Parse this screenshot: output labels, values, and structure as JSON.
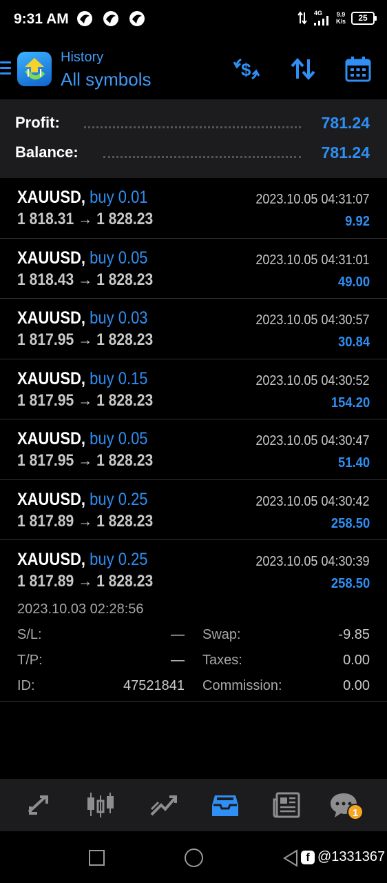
{
  "status_bar": {
    "time": "9:31 AM",
    "network_type": "4G",
    "net_speed_value": "9.9",
    "net_speed_unit": "K/s",
    "battery": "25"
  },
  "header": {
    "subtitle": "History",
    "title": "All symbols",
    "icons": [
      "menu-icon",
      "metatrader-logo",
      "currency-filter-icon",
      "sort-icon",
      "calendar-icon"
    ]
  },
  "summary": {
    "profit_label": "Profit:",
    "profit_value": "781.24",
    "balance_label": "Balance:",
    "balance_value": "781.24"
  },
  "deals": [
    {
      "symbol": "XAUUSD,",
      "side": "buy 0.01",
      "open_price": "1 818.31",
      "close_price": "1 828.23",
      "time": "2023.10.05 04:31:07",
      "profit": "9.92"
    },
    {
      "symbol": "XAUUSD,",
      "side": "buy 0.05",
      "open_price": "1 818.43",
      "close_price": "1 828.23",
      "time": "2023.10.05 04:31:01",
      "profit": "49.00"
    },
    {
      "symbol": "XAUUSD,",
      "side": "buy 0.03",
      "open_price": "1 817.95",
      "close_price": "1 828.23",
      "time": "2023.10.05 04:30:57",
      "profit": "30.84"
    },
    {
      "symbol": "XAUUSD,",
      "side": "buy 0.15",
      "open_price": "1 817.95",
      "close_price": "1 828.23",
      "time": "2023.10.05 04:30:52",
      "profit": "154.20"
    },
    {
      "symbol": "XAUUSD,",
      "side": "buy 0.05",
      "open_price": "1 817.95",
      "close_price": "1 828.23",
      "time": "2023.10.05 04:30:47",
      "profit": "51.40"
    },
    {
      "symbol": "XAUUSD,",
      "side": "buy 0.25",
      "open_price": "1 817.89",
      "close_price": "1 828.23",
      "time": "2023.10.05 04:30:42",
      "profit": "258.50"
    },
    {
      "symbol": "XAUUSD,",
      "side": "buy 0.25",
      "open_price": "1 817.89",
      "close_price": "1 828.23",
      "time": "2023.10.05 04:30:39",
      "profit": "258.50"
    }
  ],
  "arrow": "→",
  "expanded_deal": {
    "open_time": "2023.10.03 02:28:56",
    "sl_label": "S/L:",
    "sl_value": "—",
    "tp_label": "T/P:",
    "tp_value": "—",
    "id_label": "ID:",
    "id_value": "47521841",
    "swap_label": "Swap:",
    "swap_value": "-9.85",
    "taxes_label": "Taxes:",
    "taxes_value": "0.00",
    "commission_label": "Commission:",
    "commission_value": "0.00"
  },
  "bottom_nav": {
    "items": [
      "quotes-icon",
      "chart-icon",
      "trade-icon",
      "history-icon",
      "news-icon",
      "chat-icon"
    ],
    "chat_badge": "1",
    "active_color": "#2f8ff4",
    "inactive_color": "#8e8e8e"
  },
  "watermark": "@1331367",
  "colors": {
    "accent": "#2f8ff4",
    "background": "#000000",
    "panel": "#1c1c1e"
  }
}
